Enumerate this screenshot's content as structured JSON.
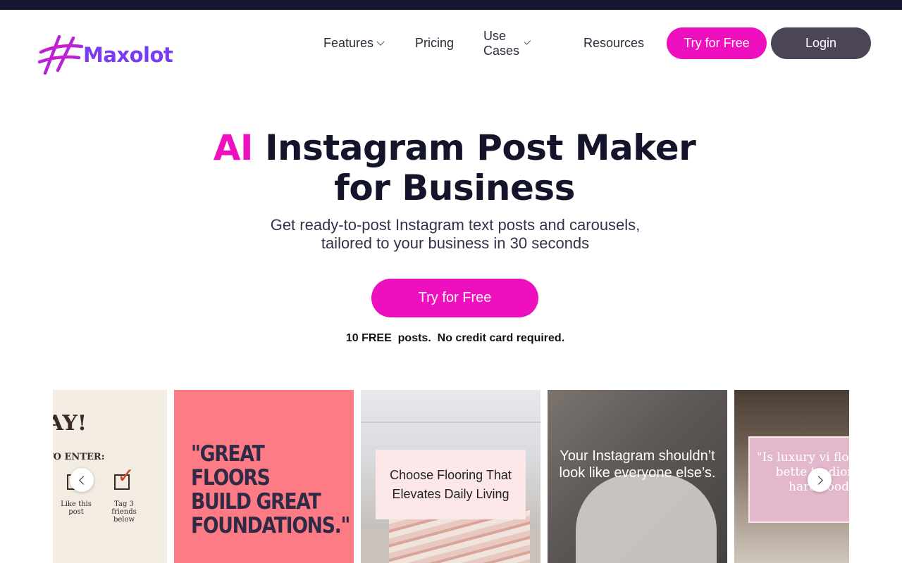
{
  "brand": {
    "name": "Maxolot",
    "logo_color": "#7a3cf0",
    "accent_color": "#ee0fbe"
  },
  "nav": {
    "features": "Features",
    "pricing": "Pricing",
    "use_cases": "Use Cases",
    "resources": "Resources",
    "try_free": "Try for Free",
    "login": "Login"
  },
  "hero": {
    "title_accent": "AI",
    "title_line1_rest": " Instagram Post Maker",
    "title_line2": "for Business",
    "subtitle_line1": "Get ready-to-post Instagram text posts and carousels,",
    "subtitle_line2": "tailored to your business in 30 seconds",
    "cta": "Try for Free",
    "note": "10 FREE  posts.  No credit card required."
  },
  "carousel": {
    "cards": [
      {
        "headline": "EAWAY!",
        "sub": "TO ENTER:",
        "item1": "Like this post",
        "item2": "Tag 3 friends below"
      },
      {
        "text": "\"GREAT FLOORS BUILD GREAT FOUNDATIONS.\""
      },
      {
        "text": "Choose Flooring That Elevates Daily Living"
      },
      {
        "text": "Your Instagram shouldn’t look like everyone else’s."
      },
      {
        "text": "\"Is luxury vi flooring bette tradiona hardwood"
      }
    ],
    "prev_icon": "chevron-left-icon",
    "next_icon": "chevron-right-icon"
  }
}
